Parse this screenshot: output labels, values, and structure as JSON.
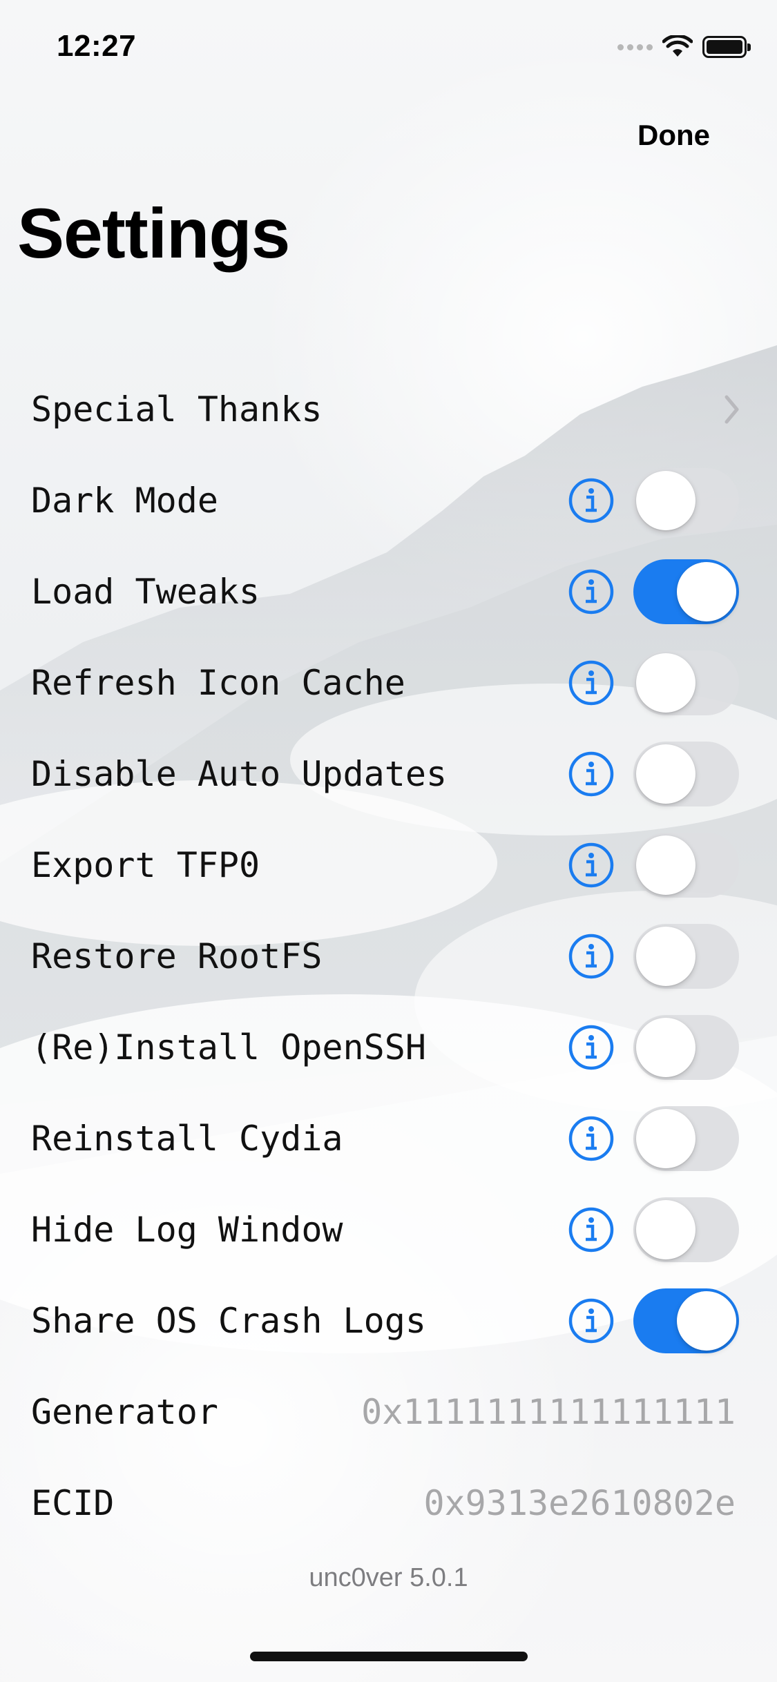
{
  "status_bar": {
    "time": "12:27"
  },
  "nav": {
    "done_label": "Done",
    "title": "Settings"
  },
  "rows": [
    {
      "label": "Special Thanks",
      "kind": "link"
    },
    {
      "label": "Dark Mode",
      "kind": "toggle",
      "on": false
    },
    {
      "label": "Load Tweaks",
      "kind": "toggle",
      "on": true
    },
    {
      "label": "Refresh Icon Cache",
      "kind": "toggle",
      "on": false
    },
    {
      "label": "Disable Auto Updates",
      "kind": "toggle",
      "on": false
    },
    {
      "label": "Export TFP0",
      "kind": "toggle",
      "on": false
    },
    {
      "label": "Restore RootFS",
      "kind": "toggle",
      "on": false
    },
    {
      "label": "(Re)Install OpenSSH",
      "kind": "toggle",
      "on": false
    },
    {
      "label": "Reinstall Cydia",
      "kind": "toggle",
      "on": false
    },
    {
      "label": "Hide Log Window",
      "kind": "toggle",
      "on": false
    },
    {
      "label": "Share OS Crash Logs",
      "kind": "toggle",
      "on": true
    },
    {
      "label": "Generator",
      "kind": "value",
      "value": "0x1111111111111111"
    },
    {
      "label": "ECID",
      "kind": "value",
      "value": "0x9313e2610802e"
    }
  ],
  "footer": {
    "version": "unc0ver 5.0.1"
  },
  "colors": {
    "accent": "#1a7cf0",
    "toggle_off": "#dddee2",
    "value_text": "#a7a7a9"
  },
  "icons": {
    "info": "info-circle-icon",
    "chevron": "chevron-right-icon"
  }
}
